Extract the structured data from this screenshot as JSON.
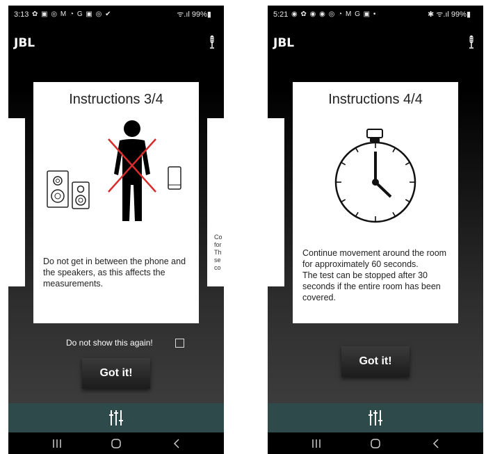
{
  "left": {
    "status": {
      "time": "3:13",
      "icons": "✿ ▣ ◎ M ◔ G ▣ ◎ ✔",
      "right": "ᯤ.ıl 99%▮"
    },
    "app_logo": "JBL",
    "card": {
      "title": "Instructions 3/4",
      "body": "Do not get in between the phone and  the speakers, as this affects the measurements."
    },
    "side_peek_text": "Co for Th se co",
    "checkbox_label": "Do not show this again!",
    "button": "Got it!"
  },
  "right": {
    "status": {
      "time": "5:21",
      "icons": "◉ ✿ ◉ ◉ ◎ ◔ M G ▣ •",
      "right": "✱ ᯤ.ıl 99%▮"
    },
    "app_logo": "JBL",
    "card": {
      "title": "Instructions 4/4",
      "body": "Continue movement around the room for approximately 60 seconds.\nThe test can be stopped after 30 seconds if the entire room has been covered."
    },
    "button": "Got it!"
  },
  "icons": [
    "microphone-icon",
    "equalizer-icon",
    "recents-icon",
    "home-icon",
    "back-icon",
    "speaker-icon",
    "person-icon",
    "phone-icon",
    "stopwatch-icon"
  ],
  "colors": {
    "bottom_bar": "#2f4a4b",
    "cross": "#d82c2c"
  }
}
